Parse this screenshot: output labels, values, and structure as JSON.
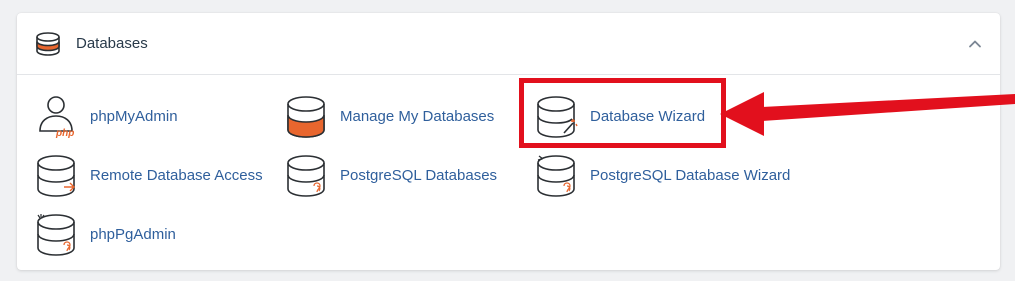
{
  "panel": {
    "title": "Databases",
    "header_icon": "database-stack-icon",
    "collapse_icon": "chevron-up-icon"
  },
  "items": [
    {
      "label": "phpMyAdmin",
      "icon": "phpmyadmin-icon"
    },
    {
      "label": "Manage My Databases",
      "icon": "manage-databases-icon"
    },
    {
      "label": "Database Wizard",
      "icon": "database-wizard-icon"
    },
    {
      "label": "Remote Database Access",
      "icon": "remote-database-icon"
    },
    {
      "label": "PostgreSQL Databases",
      "icon": "postgresql-database-icon"
    },
    {
      "label": "PostgreSQL Database Wizard",
      "icon": "postgresql-wizard-icon"
    },
    {
      "label": "phpPgAdmin",
      "icon": "phppgadmin-icon"
    }
  ],
  "annotation": {
    "highlight_color": "#e2101d",
    "highlighted_item": "Database Wizard"
  },
  "colors": {
    "link": "#2f5f9c",
    "icon_stroke": "#2b2f33",
    "icon_accent": "#e8662e",
    "background": "#f0f1f3"
  }
}
